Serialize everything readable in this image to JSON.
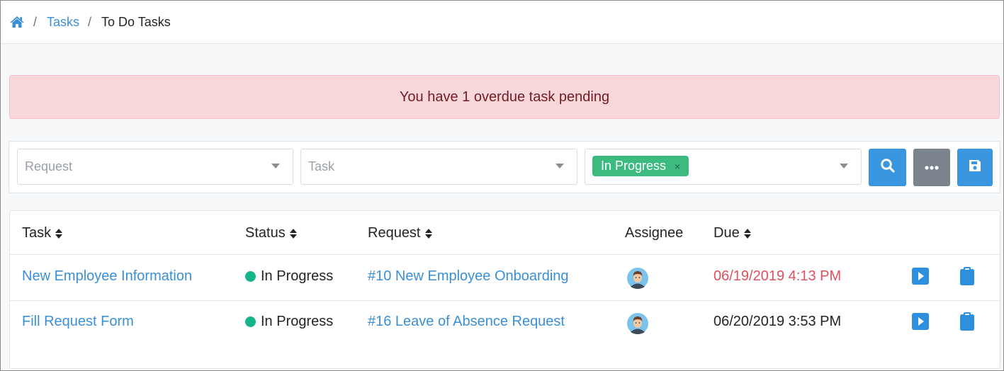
{
  "breadcrumb": {
    "home_icon": "home-icon",
    "separator": "/",
    "tasks_link": "Tasks",
    "current": "To Do Tasks"
  },
  "alert": {
    "message": "You have 1 overdue task pending"
  },
  "filters": {
    "request": {
      "placeholder": "Request"
    },
    "task": {
      "placeholder": "Task"
    },
    "status": {
      "selected_tag": "In Progress",
      "remove_symbol": "×"
    },
    "buttons": {
      "search_icon": "search-icon",
      "more_icon": "ellipsis-icon",
      "save_icon": "save-icon"
    }
  },
  "table": {
    "headers": {
      "task": "Task",
      "status": "Status",
      "request": "Request",
      "assignee": "Assignee",
      "due": "Due"
    },
    "rows": [
      {
        "task": "New Employee Information",
        "status": "In Progress",
        "request": "#10 New Employee Onboarding",
        "due": "06/19/2019 4:13 PM",
        "overdue": true
      },
      {
        "task": "Fill Request Form",
        "status": "In Progress",
        "request": "#16 Leave of Absence Request",
        "due": "06/20/2019 3:53 PM",
        "overdue": false
      }
    ]
  },
  "colors": {
    "accent": "#3b96e0",
    "link": "#3b8fd6",
    "status_green": "#16b48b",
    "tag_green": "#3dba80",
    "overdue_red": "#e0505f",
    "alert_bg": "#f8d7da",
    "gray_button": "#7b848d"
  }
}
